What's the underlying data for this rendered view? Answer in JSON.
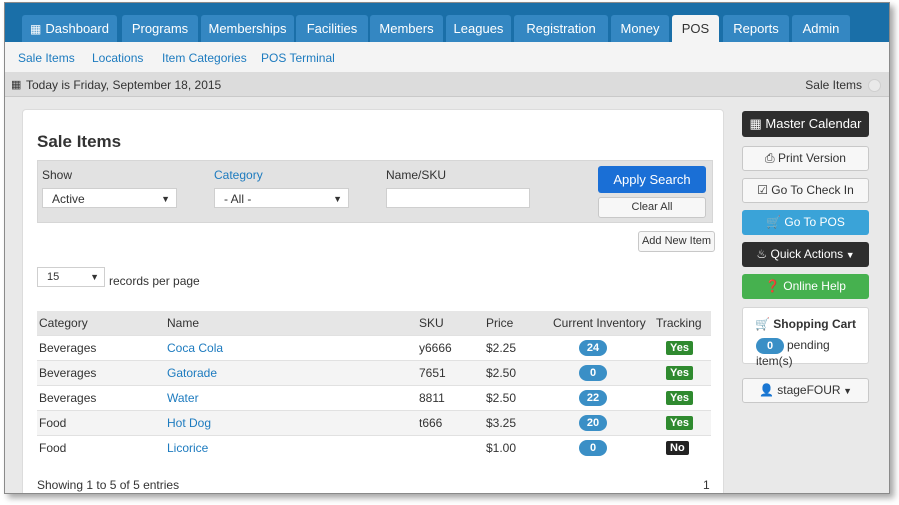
{
  "nav": {
    "tabs": [
      {
        "label": "Dashboard",
        "icon": "dashboard-icon"
      },
      {
        "label": "Programs"
      },
      {
        "label": "Memberships"
      },
      {
        "label": "Facilities"
      },
      {
        "label": "Members"
      },
      {
        "label": "Leagues"
      },
      {
        "label": "Registration"
      },
      {
        "label": "Money"
      },
      {
        "label": "POS",
        "active": true
      },
      {
        "label": "Reports"
      },
      {
        "label": "Admin"
      }
    ]
  },
  "subnav": {
    "links": [
      "Sale Items",
      "Locations",
      "Item Categories",
      "POS Terminal"
    ]
  },
  "datebar": {
    "text": "Today is Friday, September 18, 2015",
    "right": "Sale Items"
  },
  "panel": {
    "title": "Sale Items",
    "filters": {
      "show_label": "Show",
      "show_value": "Active",
      "category_label": "Category",
      "category_value": "- All -",
      "name_label": "Name/SKU",
      "name_value": "",
      "apply_label": "Apply Search",
      "clear_label": "Clear All"
    },
    "add_new_label": "Add New Item",
    "per_page_value": "15",
    "per_page_label": "records per page",
    "table": {
      "headers": [
        "Category",
        "Name",
        "SKU",
        "Price",
        "Current Inventory",
        "Tracking"
      ],
      "rows": [
        {
          "category": "Beverages",
          "name": "Coca Cola",
          "sku": "y6666",
          "price": "$2.25",
          "inventory": "24",
          "tracking": "Yes"
        },
        {
          "category": "Beverages",
          "name": "Gatorade",
          "sku": "7651",
          "price": "$2.50",
          "inventory": "0",
          "tracking": "Yes"
        },
        {
          "category": "Beverages",
          "name": "Water",
          "sku": "8811",
          "price": "$2.50",
          "inventory": "22",
          "tracking": "Yes"
        },
        {
          "category": "Food",
          "name": "Hot Dog",
          "sku": "t666",
          "price": "$3.25",
          "inventory": "20",
          "tracking": "Yes"
        },
        {
          "category": "Food",
          "name": "Licorice",
          "sku": "",
          "price": "$1.00",
          "inventory": "0",
          "tracking": "No"
        }
      ]
    },
    "showing": "Showing 1 to 5 of 5 entries",
    "page": "1"
  },
  "sidebar": {
    "master_calendar": "Master Calendar",
    "print_version": "Print Version",
    "go_to_check_in": "Go To Check In",
    "go_to_pos": "Go To POS",
    "quick_actions": "Quick Actions",
    "online_help": "Online Help",
    "cart_title": "Shopping Cart",
    "cart_count": "0",
    "cart_pending": "pending item(s)",
    "user_name": "stageFOUR"
  },
  "colors": {
    "topnav": "#1a6fa8",
    "tab": "#3487c2",
    "primary": "#1a6fd6",
    "yes": "#2f8a2f",
    "badge": "#3a8fc6"
  }
}
